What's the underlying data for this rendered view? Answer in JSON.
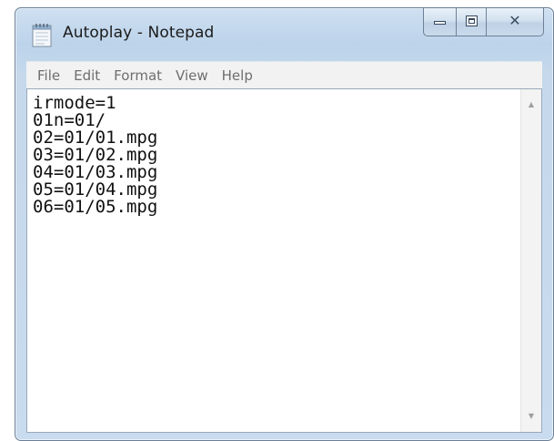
{
  "window": {
    "title": "Autoplay - Notepad",
    "app_icon": "notepad-icon",
    "controls": {
      "minimize_icon": "minimize-icon",
      "maximize_icon": "maximize-icon",
      "close_icon": "close-icon",
      "close_glyph": "✕"
    }
  },
  "menu": {
    "items": [
      {
        "label": "File"
      },
      {
        "label": "Edit"
      },
      {
        "label": "Format"
      },
      {
        "label": "View"
      },
      {
        "label": "Help"
      }
    ]
  },
  "editor": {
    "lines": [
      "irmode=1",
      "01n=01/",
      "02=01/01.mpg",
      "03=01/02.mpg",
      "04=01/03.mpg",
      "05=01/04.mpg",
      "06=01/05.mpg"
    ]
  },
  "scrollbar": {
    "up_arrow": "▲",
    "down_arrow": "▼"
  },
  "colors": {
    "frame": "#c5d8ec",
    "menubar": "#f2f2f2",
    "menu_text": "#6e6e6e"
  }
}
